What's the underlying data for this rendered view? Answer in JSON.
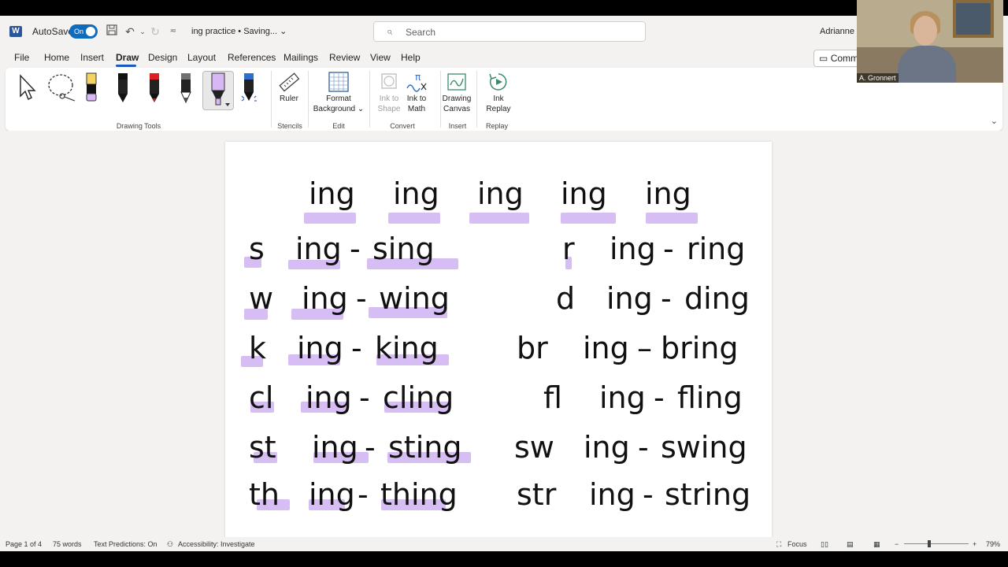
{
  "titlebar": {
    "app_icon": "W",
    "autosave_label": "AutoSave",
    "autosave_state": "On",
    "doc_title": "ing practice • Saving... ⌄",
    "search_placeholder": "Search",
    "user_name": "Adrianne G"
  },
  "tabs": [
    "File",
    "Home",
    "Insert",
    "Draw",
    "Design",
    "Layout",
    "References",
    "Mailings",
    "Review",
    "View",
    "Help"
  ],
  "active_tab": "Draw",
  "comments_label": "Comm",
  "ribbon": {
    "groups": {
      "drawing_tools": "Drawing Tools",
      "stencils": "Stencils",
      "edit": "Edit",
      "convert": "Convert",
      "insert": "Insert",
      "replay": "Replay"
    },
    "buttons": {
      "ruler": "Ruler",
      "format_background_1": "Format",
      "format_background_2": "Background ⌄",
      "ink_to_shape_1": "Ink to",
      "ink_to_shape_2": "Shape",
      "ink_to_math_1": "Ink to",
      "ink_to_math_2": "Math",
      "drawing_canvas_1": "Drawing",
      "drawing_canvas_2": "Canvas",
      "ink_replay_1": "Ink",
      "ink_replay_2": "Replay"
    },
    "pen_colors": [
      "#000000",
      "#e02020",
      "#707070",
      "#d8b8f4",
      "#2f6ecf"
    ]
  },
  "document": {
    "header_row": [
      "ing",
      "ing",
      "ing",
      "ing",
      "ing"
    ],
    "left": [
      {
        "prefix": "s",
        "stem": "ing",
        "dash": "-",
        "word": "sing"
      },
      {
        "prefix": "w",
        "stem": "ing",
        "dash": "-",
        "word": "wing"
      },
      {
        "prefix": "k",
        "stem": "ing",
        "dash": "-",
        "word": "king"
      },
      {
        "prefix": "cl",
        "stem": "ing",
        "dash": "-",
        "word": "cling"
      },
      {
        "prefix": "st",
        "stem": "ing",
        "dash": "-",
        "word": "sting"
      },
      {
        "prefix": "th",
        "stem": "ing",
        "dash": "-",
        "word": "thing"
      }
    ],
    "right": [
      {
        "prefix": "r",
        "stem": "ing",
        "dash": "-",
        "word": "ring"
      },
      {
        "prefix": "d",
        "stem": "ing",
        "dash": "-",
        "word": "ding"
      },
      {
        "prefix": "br",
        "stem": "ing",
        "dash": "–",
        "word": "bring"
      },
      {
        "prefix": "fl",
        "stem": "ing",
        "dash": "-",
        "word": "fling"
      },
      {
        "prefix": "sw",
        "stem": "ing",
        "dash": "-",
        "word": "swing"
      },
      {
        "prefix": "str",
        "stem": "ing",
        "dash": "-",
        "word": "string"
      }
    ],
    "highlight_color": "#c8a8f0"
  },
  "status": {
    "page": "Page 1 of 4",
    "words": "75 words",
    "text_predictions": "Text Predictions: On",
    "accessibility": "Accessibility: Investigate",
    "focus": "Focus",
    "zoom": "79%"
  },
  "webcam": {
    "name": "A. Gronnert"
  }
}
